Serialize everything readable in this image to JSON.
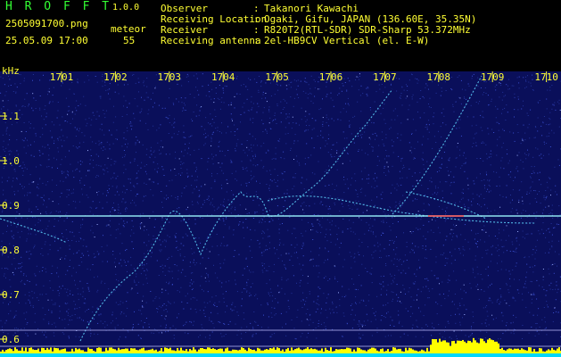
{
  "header": {
    "app_title": "H R O F F T",
    "version": "1.0.0",
    "filename": "2505091700.png",
    "datetime": "25.05.09 17:00",
    "mode_label": "meteor",
    "count": "55"
  },
  "info": [
    {
      "label": "Observer",
      "value": "Takanori Kawachi"
    },
    {
      "label": "Receiving Location",
      "value": "Ogaki, Gifu, JAPAN (136.60E, 35.35N)"
    },
    {
      "label": "Receiver",
      "value": "R820T2(RTL-SDR) SDR-Sharp 53.372MHz"
    },
    {
      "label": "Receiving antenna",
      "value": "2el-HB9CV Vertical (el. E-W)"
    }
  ],
  "chart_data": {
    "type": "heatmap",
    "ylabel": "kHz",
    "x_ticks": [
      "1701",
      "1702",
      "1703",
      "1704",
      "1705",
      "1706",
      "1707",
      "1708",
      "1709",
      "1710"
    ],
    "y_ticks": [
      "1.1",
      "1.0",
      "0.9",
      "0.8",
      "0.7",
      "0.6"
    ],
    "ylim": [
      0.6,
      1.15
    ],
    "carrier_khz": 0.876,
    "colors": {
      "background": "#0a0f5a",
      "noise_light": "#3a4fd0",
      "trace": "#5fd6ff",
      "text_green": "#33ff33",
      "text_yellow": "#ffff33",
      "level": "#ffff00",
      "level_base": "#00d8ff"
    }
  }
}
